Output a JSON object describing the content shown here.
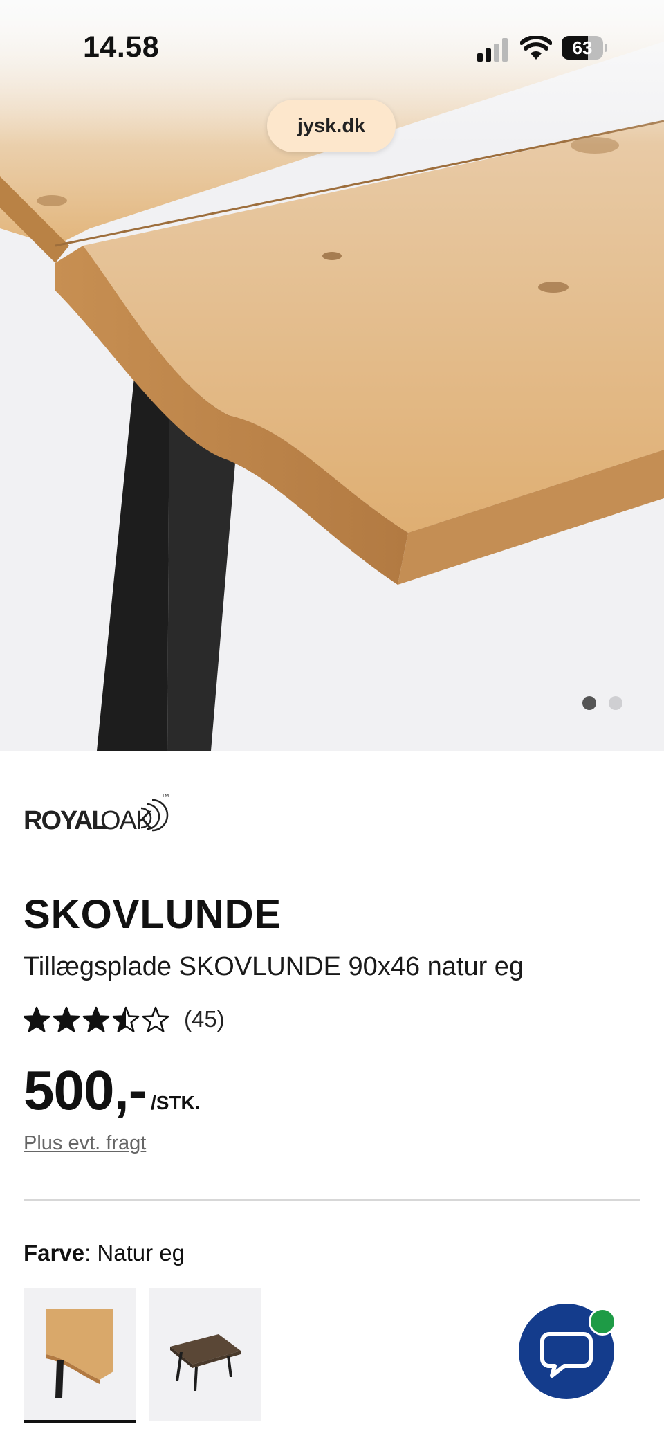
{
  "status_bar": {
    "time": "14.58",
    "battery_level": "63",
    "battery_fraction": 0.63
  },
  "browser": {
    "url": "jysk.dk"
  },
  "gallery": {
    "image_count": 2,
    "active_index": 0
  },
  "product": {
    "brand": "ROYALOAK",
    "name": "SKOVLUNDE",
    "description": "Tillægsplade SKOVLUNDE 90x46 natur eg",
    "rating": 3.5,
    "rating_max": 5,
    "review_count": "(45)",
    "price": "500,-",
    "unit": "/STK.",
    "shipping_note": "Plus evt. fragt"
  },
  "color_selector": {
    "label": "Farve",
    "separator": ": ",
    "value": "Natur eg",
    "options": [
      "natur eg",
      "mørk eg"
    ],
    "selected_index": 0
  },
  "colors": {
    "chat_button": "#143c8c",
    "chat_badge": "#1e9b46",
    "url_pill": "#fde7cc",
    "wood": "#d9a86a"
  },
  "icons": {
    "chat": "chat-bubble-icon",
    "signal": "cellular-signal-icon",
    "wifi": "wifi-icon",
    "battery": "battery-icon",
    "star": "star-icon"
  }
}
